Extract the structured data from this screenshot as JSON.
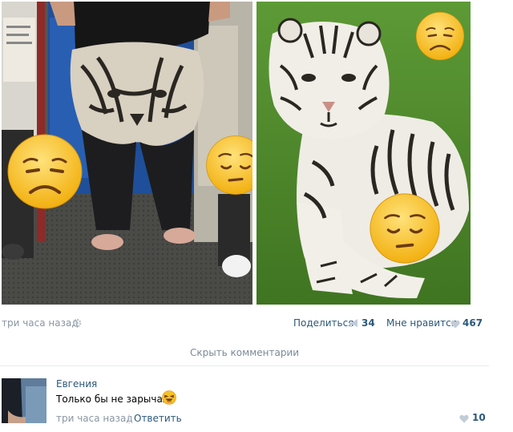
{
  "post": {
    "time": "три часа назад",
    "share_label": "Поделиться",
    "share_count": "34",
    "like_label": "Мне нравится",
    "like_count": "467"
  },
  "comments_toggle": "Скрыть комментарии",
  "comment": {
    "author": "Евгения",
    "text": "Только бы не зарычал",
    "time": "три часа назад",
    "reply_label": "Ответить",
    "like_count": "10"
  },
  "colors": {
    "link": "#2b587a",
    "muted": "#8a96a3",
    "emoji_face": "#f6c026"
  },
  "icons": [
    "gear-icon",
    "megaphone-icon",
    "heart-icon",
    "sad-emoji-icon",
    "pensive-emoji-icon",
    "laughing-emoji-icon"
  ]
}
